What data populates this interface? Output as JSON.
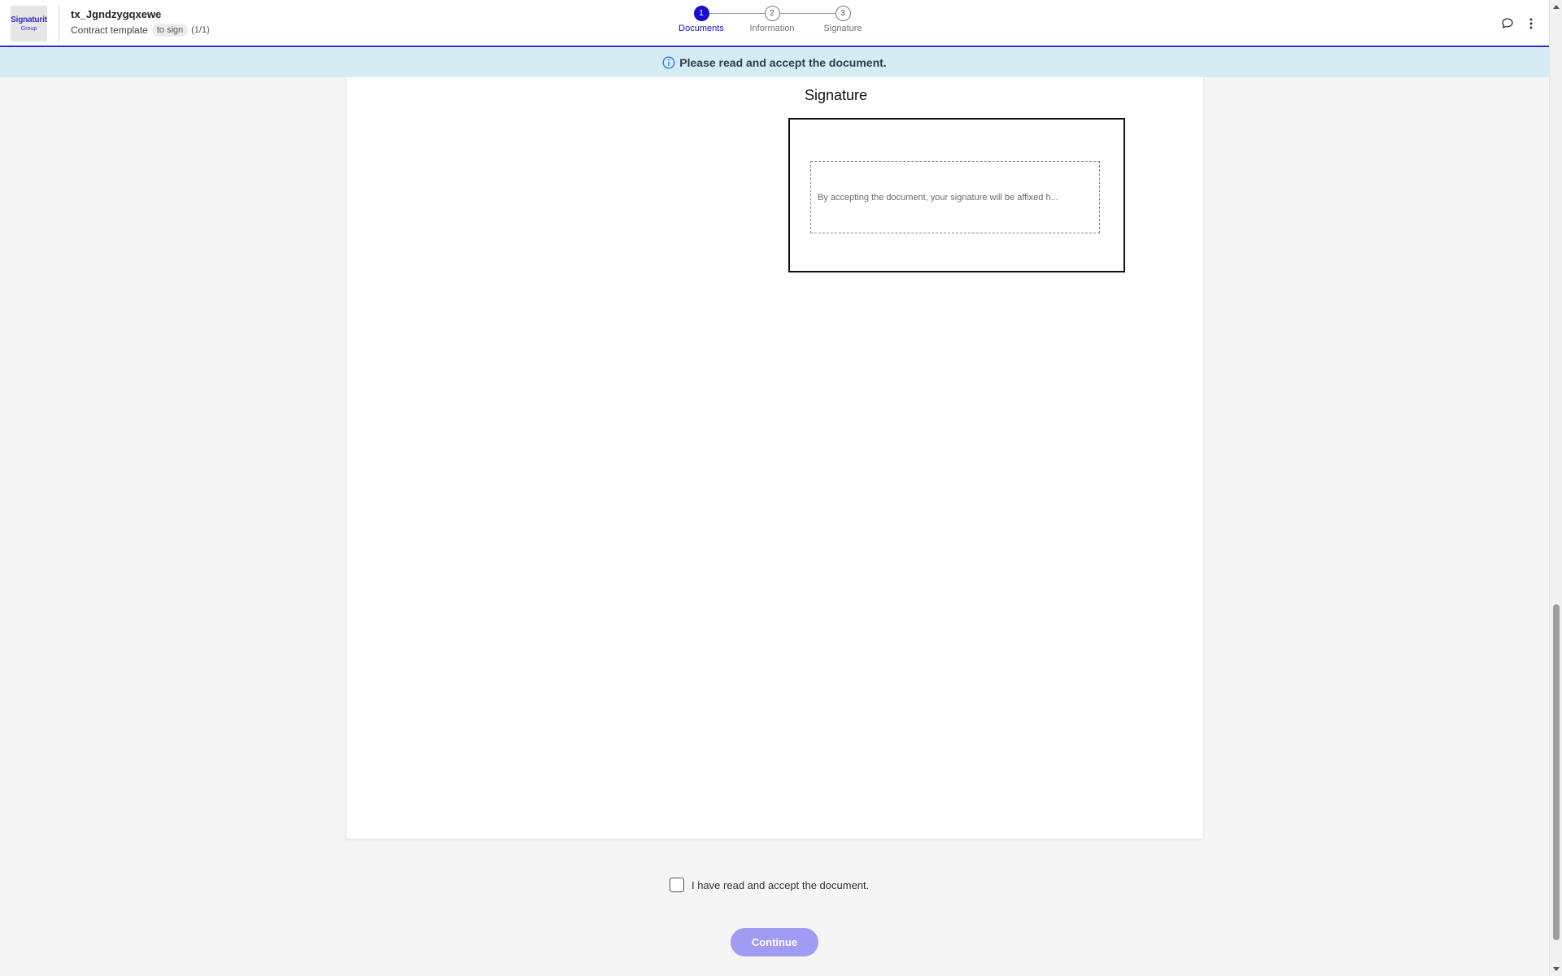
{
  "header": {
    "logo": {
      "text": "Signaturit",
      "sub": "Group"
    },
    "title": "tx_Jgndzygqxewe",
    "subtitle": "Contract template",
    "status_tag": "to sign",
    "doc_count": "(1/1)",
    "icons": {
      "chat": "chat-bubble-icon",
      "menu": "more-vertical-icon"
    }
  },
  "stepper": {
    "steps": [
      {
        "number": "1",
        "label": "Documents",
        "active": true
      },
      {
        "number": "2",
        "label": "Information",
        "active": false
      },
      {
        "number": "3",
        "label": "Signature",
        "active": false
      }
    ]
  },
  "banner": {
    "icon": "info-circle-icon",
    "text": "Please read and accept the document."
  },
  "document": {
    "signature_heading": "Signature",
    "signature_placeholder": "By accepting the document, your signature will be affixed h..."
  },
  "accept": {
    "label": "I have read and accept the document.",
    "checked": false
  },
  "actions": {
    "continue_label": "Continue"
  },
  "colors": {
    "accent": "#1a0fd0",
    "banner_bg": "#d6ecf5",
    "button_disabled": "#a19cf3"
  }
}
